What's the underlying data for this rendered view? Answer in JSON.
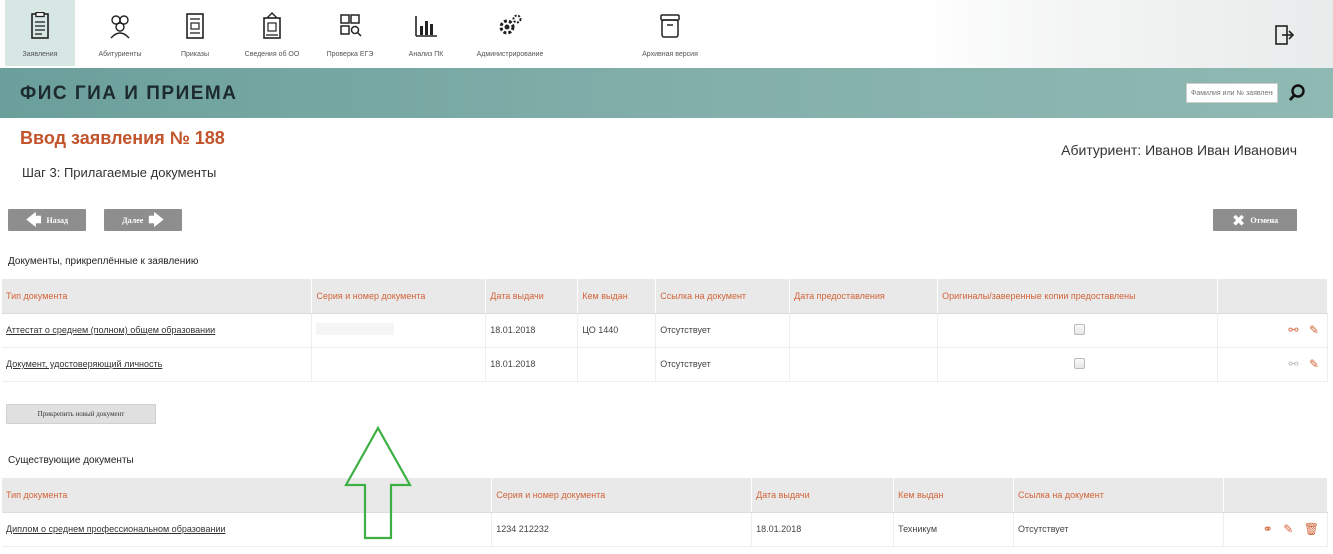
{
  "toolbar": {
    "items": [
      {
        "label": "Заявления",
        "icon": "applications-icon"
      },
      {
        "label": "Абитуриенты",
        "icon": "applicants-icon"
      },
      {
        "label": "Приказы",
        "icon": "orders-icon"
      },
      {
        "label": "Сведения об ОО",
        "icon": "organization-icon"
      },
      {
        "label": "Проверка ЕГЭ",
        "icon": "exam-check-icon"
      },
      {
        "label": "Анализ ПК",
        "icon": "analytics-icon"
      },
      {
        "label": "Администрирование",
        "icon": "gears-icon"
      },
      {
        "label": "Архивная версия",
        "icon": "archive-icon"
      }
    ],
    "exit_icon": "exit-icon"
  },
  "header": {
    "title": "ФИС ГИА И ПРИЕМА",
    "search_placeholder": "Фамилия или № заявления"
  },
  "page": {
    "title": "Ввод заявления № 188",
    "step": "Шаг 3: Прилагаемые документы",
    "applicant": "Абитуриент: Иванов Иван Иванович"
  },
  "nav": {
    "back_label": "Назад",
    "next_label": "Далее",
    "cancel_label": "Отмена"
  },
  "attached": {
    "section_title": "Документы, прикреплённые к заявлению",
    "columns": [
      "Тип документа",
      "Серия и номер документа",
      "Дата выдачи",
      "Кем выдан",
      "Ссылка на документ",
      "Дата предоставления",
      "Оригиналы/заверенные копии предоставлены"
    ],
    "rows": [
      {
        "type": "Аттестат о среднем (полном) общем образовании",
        "number": "",
        "date": "18.01.2018",
        "issuer": "ЦО 1440",
        "link": "Отсутствует",
        "provided_date": "",
        "originals": false
      },
      {
        "type": "Документ, удостоверяющий личность",
        "number": "",
        "date": "18.01.2018",
        "issuer": "",
        "link": "Отсутствует",
        "provided_date": "",
        "originals": false
      }
    ],
    "attach_button": "Прикрепить новый документ"
  },
  "existing": {
    "section_title": "Существующие документы",
    "columns": [
      "Тип документа",
      "Серия и номер документа",
      "Дата выдачи",
      "Кем выдан",
      "Ссылка на документ"
    ],
    "rows": [
      {
        "type": "Диплом о среднем профессиональном образовании",
        "number": "1234 212232",
        "date": "18.01.2018",
        "issuer": "Техникум",
        "link": "Отсутствует"
      }
    ]
  },
  "colors": {
    "accent": "#d2643a",
    "header_green": "#7aa9a4",
    "arrow_green": "#3cb043"
  }
}
